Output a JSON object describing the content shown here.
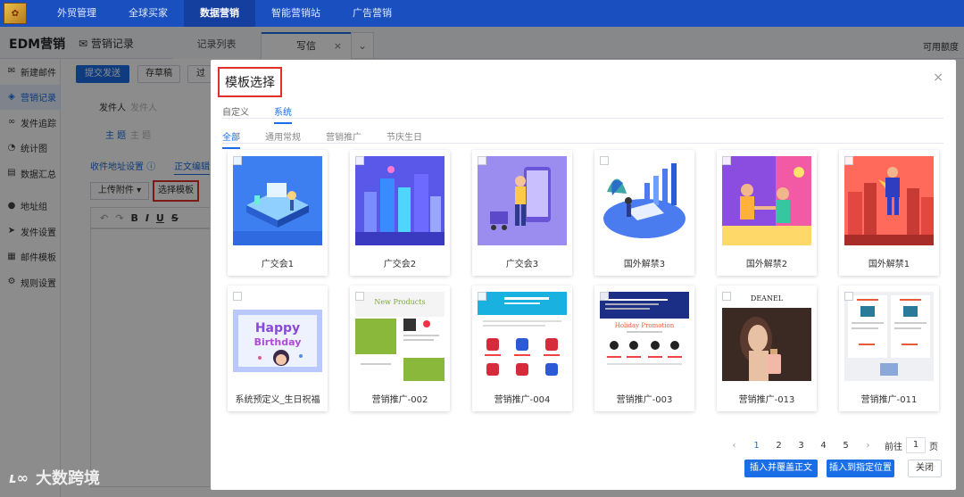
{
  "topnav": {
    "items": [
      "外贸管理",
      "全球买家",
      "数据营销",
      "智能营销站",
      "广告营销"
    ],
    "active_index": 2
  },
  "header": {
    "app_title": "EDM营销",
    "section_title": "营销记录",
    "tabs": [
      {
        "label": "记录列表"
      },
      {
        "label": "写信"
      }
    ],
    "credit_label": "可用额度"
  },
  "sidebar": {
    "items": [
      {
        "label": "新建邮件",
        "icon": "mail-icon"
      },
      {
        "label": "营销记录",
        "icon": "layers-icon",
        "active": true
      },
      {
        "label": "发件追踪",
        "icon": "binoculars-icon"
      },
      {
        "label": "统计图",
        "icon": "pie-chart-icon"
      },
      {
        "label": "数据汇总",
        "icon": "database-icon"
      },
      {
        "label": "地址组",
        "icon": "location-icon"
      },
      {
        "label": "发件设置",
        "icon": "send-icon"
      },
      {
        "label": "邮件模板",
        "icon": "template-icon"
      },
      {
        "label": "规则设置",
        "icon": "gear-icon"
      }
    ]
  },
  "editor": {
    "send_button": "提交发送",
    "draft_button": "存草稿",
    "over_button": "过",
    "sender_label": "发件人",
    "sender_placeholder": "发件人",
    "subject_label": "主 题",
    "subject_placeholder": "主 题",
    "recipient_link": "收件地址设置",
    "body_tab": "正文编辑",
    "upload_button": "上传附件",
    "choose_template_button": "选择模板"
  },
  "modal": {
    "title": "模板选择",
    "tabs": [
      "自定义",
      "系统"
    ],
    "active_tab": 1,
    "categories": [
      "全部",
      "通用常规",
      "营销推广",
      "节庆生日"
    ],
    "active_category": 0,
    "templates": [
      {
        "name": "广交会1",
        "art": "isometric-blue"
      },
      {
        "name": "广交会2",
        "art": "city-blue"
      },
      {
        "name": "广交会3",
        "art": "person-purple"
      },
      {
        "name": "国外解禁3",
        "art": "chart-plants"
      },
      {
        "name": "国外解禁2",
        "art": "meeting-pink"
      },
      {
        "name": "国外解禁1",
        "art": "hero-red"
      },
      {
        "name": "系统预定义_生日祝福",
        "art": "birthday"
      },
      {
        "name": "营销推广-002",
        "art": "new-products"
      },
      {
        "name": "营销推广-004",
        "art": "holiday-cyan"
      },
      {
        "name": "营销推广-003",
        "art": "holiday-navy"
      },
      {
        "name": "营销推广-013",
        "art": "deanel"
      },
      {
        "name": "营销推广-011",
        "art": "products-gray"
      }
    ],
    "thumb_text": {
      "new_products": "New Products",
      "holiday_promotion": "Holiday Promotion",
      "deanel": "DEANEL",
      "happy": "Happy",
      "birthday": "Birthday"
    },
    "pagination": {
      "pages": [
        "1",
        "2",
        "3",
        "4",
        "5"
      ],
      "current": 0,
      "goto_label": "前往",
      "goto_value": "1",
      "page_suffix": "页"
    },
    "buttons": {
      "insert_cover": "插入并覆盖正文",
      "insert_position": "插入到指定位置",
      "close": "关闭"
    }
  },
  "watermark": "大数跨境"
}
